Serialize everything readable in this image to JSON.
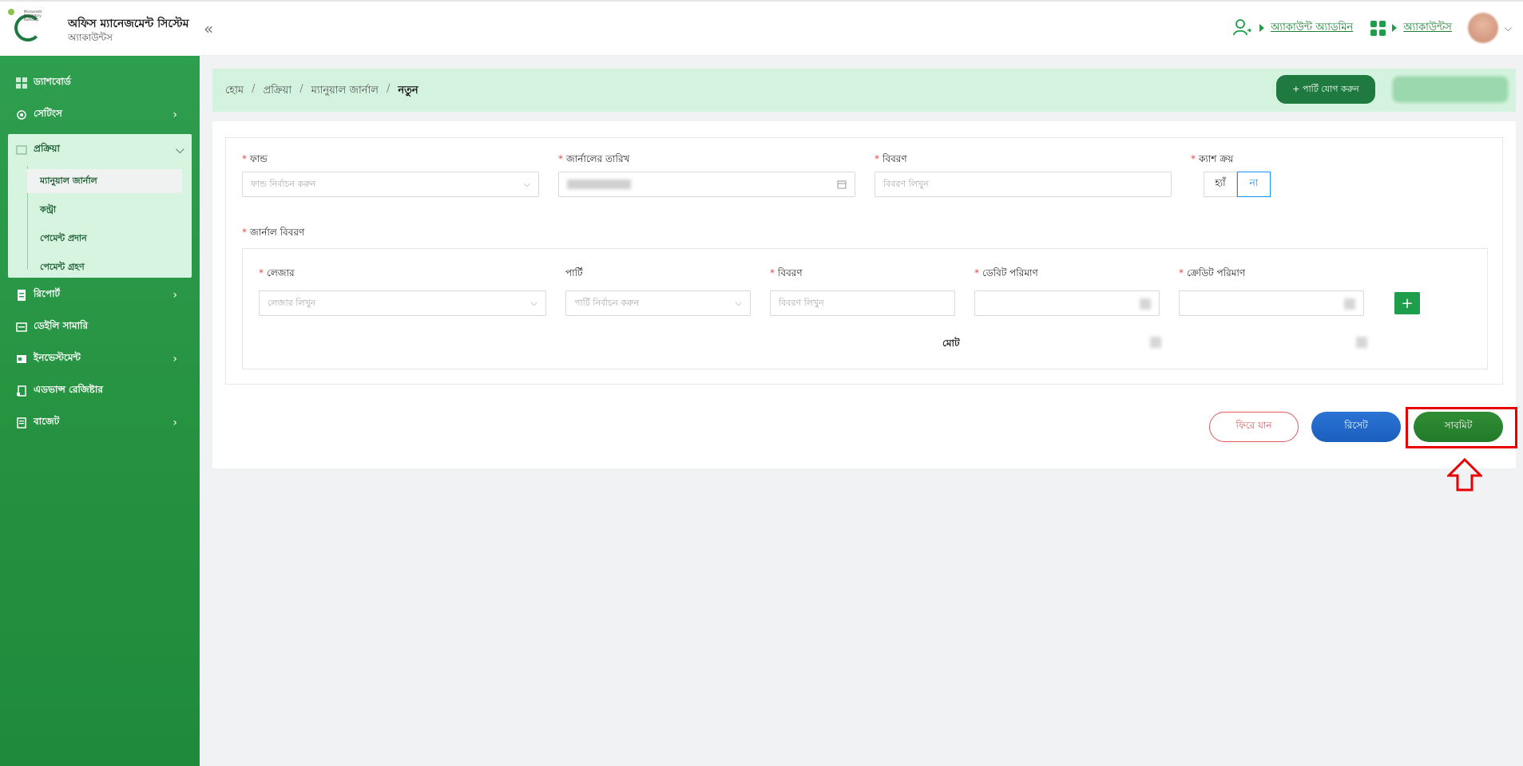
{
  "header": {
    "logo_text": "Microcredit Regulatory Authority",
    "app_title": "অফিস ম্যানেজমেন্ট সিস্টেম",
    "app_subtitle": "অ্যাকাউন্টস",
    "collapse_icon": "«",
    "role_link": "অ্যাকাউন্ট অ্যাডমিন",
    "module_link": "অ্যাকাউন্টস"
  },
  "sidebar": {
    "items": [
      {
        "label": "ড্যাশবোর্ড",
        "icon": "dashboard-icon"
      },
      {
        "label": "সেটিংস",
        "icon": "gear-icon"
      },
      {
        "label": "প্রক্রিয়া",
        "icon": "process-icon"
      },
      {
        "label": "রিপোর্ট",
        "icon": "report-icon"
      },
      {
        "label": "ডেইলি সামারি",
        "icon": "summary-icon"
      },
      {
        "label": "ইনভেস্টমেন্ট",
        "icon": "investment-icon"
      },
      {
        "label": "এডভান্স রেজিষ্টার",
        "icon": "register-icon"
      },
      {
        "label": "বাজেট",
        "icon": "budget-icon"
      }
    ],
    "sub_items": [
      "ম্যানুয়াল জার্নাল",
      "কন্ট্রা",
      "পেমেন্ট প্রদান",
      "পেমেন্ট গ্রহণ"
    ]
  },
  "breadcrumb": {
    "home": "হোম",
    "process": "প্রক্রিয়া",
    "manual_journal": "ম্যানুয়াল জার্নাল",
    "current": "নতুন",
    "add_party_label": "+ পার্টি যোগ করুন"
  },
  "form": {
    "fund_label": "ফান্ড",
    "fund_placeholder": "ফান্ড নির্বাচন করুন",
    "journal_date_label": "জার্নালের তারিখ",
    "description_label": "বিবরণ",
    "description_placeholder": "বিবরণ লিখুন",
    "cash_buy_label": "ক্যাশ ক্রয়",
    "yes": "হ্যাঁ",
    "no": "না",
    "journal_details_label": "জার্নাল বিবরণ",
    "ledger_label": "লেজার",
    "ledger_placeholder": "লেজার লিখুন",
    "party_label": "পার্টি",
    "party_placeholder": "পার্টি নির্বাচন করুন",
    "row_description_label": "বিবরণ",
    "row_description_placeholder": "বিবরণ লিখুন",
    "debit_label": "ডেবিট পরিমাণ",
    "credit_label": "ক্রেডিট পরিমাণ",
    "total_label": "মোট",
    "plus": "+"
  },
  "actions": {
    "back": "ফিরে যান",
    "reset": "রিসেট",
    "submit": "সাবমিট"
  },
  "colors": {
    "brand_green": "#1f7a3f",
    "reset_blue": "#1b5fbd",
    "highlight_red": "#e80000"
  }
}
